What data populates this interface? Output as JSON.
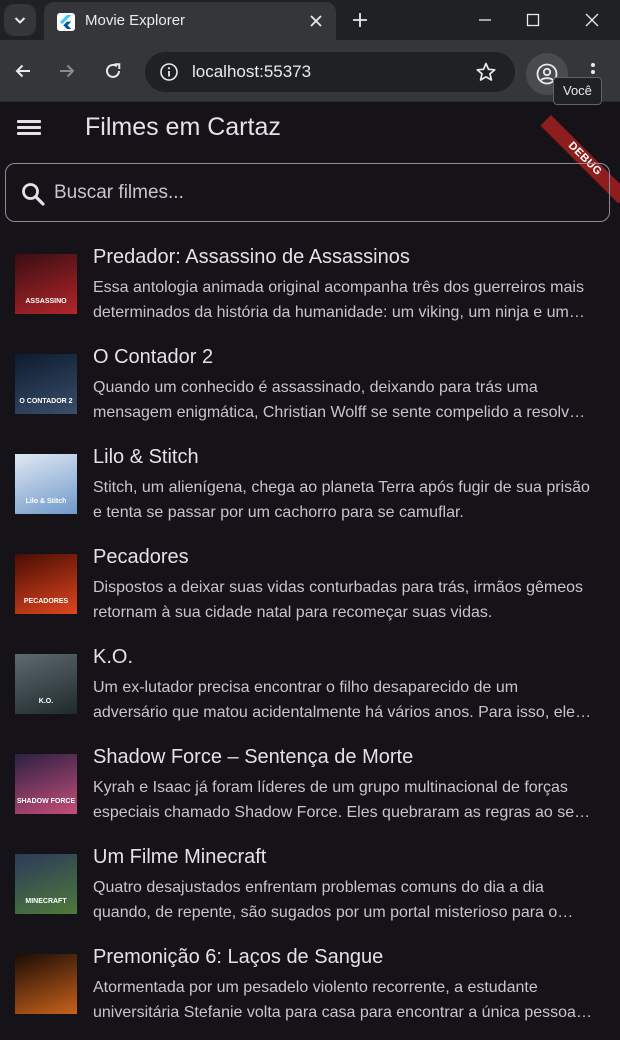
{
  "browser": {
    "tab_title": "Movie Explorer",
    "url": "localhost:55373",
    "profile_tooltip": "Você"
  },
  "app": {
    "title": "Filmes em Cartaz",
    "debug_label": "DEBUG",
    "search_placeholder": "Buscar filmes..."
  },
  "movies": [
    {
      "title": "Predador: Assassino de Assassinos",
      "overview": "Essa antologia animada original acompanha três dos guerreiros mais determinados da história da humanidade: um viking, um ninja e um piloto da Segunda Guerra Mundial.",
      "poster_colors": [
        "#3a0e12",
        "#b3262b"
      ],
      "poster_text": "ASSASSINO"
    },
    {
      "title": "O Contador 2",
      "overview": "Quando um conhecido é assassinado, deixando para trás uma mensagem enigmática, Christian Wolff se sente compelido a resolver o caso.",
      "poster_colors": [
        "#0d1b2e",
        "#3a4e6b"
      ],
      "poster_text": "O CONTADOR 2"
    },
    {
      "title": "Lilo & Stitch",
      "overview": "Stitch, um alienígena, chega ao planeta Terra após fugir de sua prisão e tenta se passar por um cachorro para se camuflar.",
      "poster_colors": [
        "#dfe8f3",
        "#6f98c9"
      ],
      "poster_text": "Lilo & Stitch"
    },
    {
      "title": "Pecadores",
      "overview": "Dispostos a deixar suas vidas conturbadas para trás, irmãos gêmeos retornam à sua cidade natal para recomeçar suas vidas.",
      "poster_colors": [
        "#4a0d05",
        "#e0461d"
      ],
      "poster_text": "PECADORES"
    },
    {
      "title": "K.O.",
      "overview": "Um ex-lutador precisa encontrar o filho desaparecido de um adversário que matou acidentalmente há vários anos. Para isso, ele enfrenta o submundo.",
      "poster_colors": [
        "#5d6a6e",
        "#1f2a2c"
      ],
      "poster_text": "K.O."
    },
    {
      "title": "Shadow Force – Sentença de Morte",
      "overview": "Kyrah e Isaac já foram líderes de um grupo multinacional de forças especiais chamado Shadow Force. Eles quebraram as regras ao se apaixonar.",
      "poster_colors": [
        "#2b2142",
        "#c64d7a"
      ],
      "poster_text": "SHADOW FORCE"
    },
    {
      "title": "Um Filme Minecraft",
      "overview": "Quatro desajustados enfrentam problemas comuns do dia a dia quando, de repente, são sugados por um portal misterioso para o Overworld.",
      "poster_colors": [
        "#2c3a5a",
        "#4e7a3a"
      ],
      "poster_text": "MINECRAFT"
    },
    {
      "title": "Premonição 6: Laços de Sangue",
      "overview": "Atormentada por um pesadelo violento recorrente, a estudante universitária Stefanie volta para casa para encontrar a única pessoa que pode ajudar.",
      "poster_colors": [
        "#1b0c05",
        "#c9621c"
      ],
      "poster_text": ""
    }
  ]
}
